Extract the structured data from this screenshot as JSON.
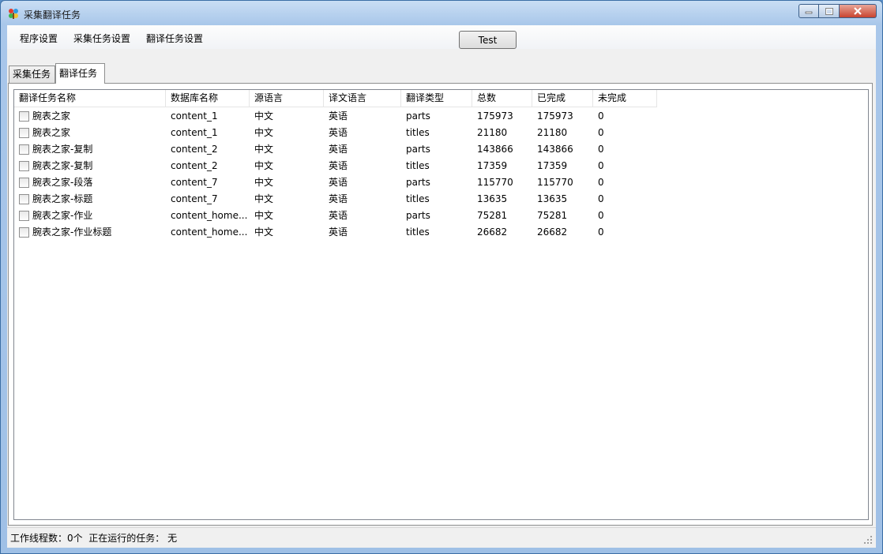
{
  "window": {
    "title": "采集翻译任务"
  },
  "menu": {
    "items": [
      "程序设置",
      "采集任务设置",
      "翻译任务设置"
    ],
    "test_button": "Test"
  },
  "tabs": [
    {
      "label": "采集任务",
      "active": false
    },
    {
      "label": "翻译任务",
      "active": true
    }
  ],
  "table": {
    "columns": [
      "翻译任务名称",
      "数据库名称",
      "源语言",
      "译文语言",
      "翻译类型",
      "总数",
      "已完成",
      "未完成"
    ],
    "rows": [
      [
        "腕表之家",
        "content_1",
        "中文",
        "英语",
        "parts",
        "175973",
        "175973",
        "0"
      ],
      [
        "腕表之家",
        "content_1",
        "中文",
        "英语",
        "titles",
        "21180",
        "21180",
        "0"
      ],
      [
        "腕表之家-复制",
        "content_2",
        "中文",
        "英语",
        "parts",
        "143866",
        "143866",
        "0"
      ],
      [
        "腕表之家-复制",
        "content_2",
        "中文",
        "英语",
        "titles",
        "17359",
        "17359",
        "0"
      ],
      [
        "腕表之家-段落",
        "content_7",
        "中文",
        "英语",
        "parts",
        "115770",
        "115770",
        "0"
      ],
      [
        "腕表之家-标题",
        "content_7",
        "中文",
        "英语",
        "titles",
        "13635",
        "13635",
        "0"
      ],
      [
        "腕表之家-作业",
        "content_home...",
        "中文",
        "英语",
        "parts",
        "75281",
        "75281",
        "0"
      ],
      [
        "腕表之家-作业标题",
        "content_home...",
        "中文",
        "英语",
        "titles",
        "26682",
        "26682",
        "0"
      ]
    ]
  },
  "statusbar": {
    "threads_label": "工作线程数：0个",
    "running_label": "正在运行的任务：",
    "running_value": "无"
  },
  "icons": {
    "app": "app-logo-icon",
    "minimize": "minimize-icon",
    "maximize": "maximize-icon",
    "close": "close-icon",
    "grip": "resize-grip-icon"
  }
}
